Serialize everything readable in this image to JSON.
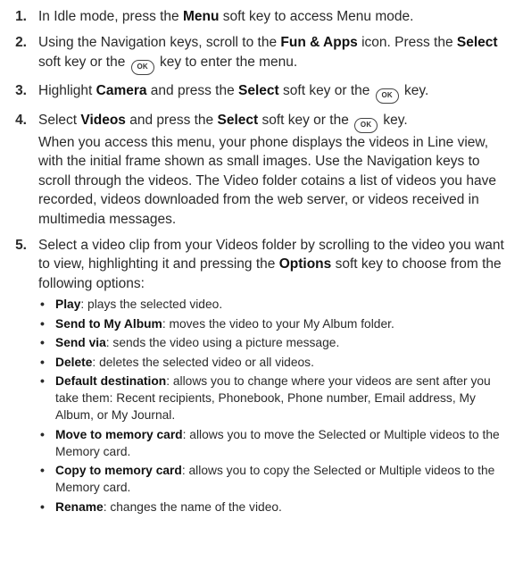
{
  "ok_key_label": "OK",
  "steps": [
    {
      "num": "1.",
      "parts": [
        "In Idle mode, press the ",
        "Menu",
        " soft key to access Menu mode."
      ]
    },
    {
      "num": "2.",
      "parts": [
        "Using the Navigation keys, scroll to the ",
        "Fun & Apps",
        " icon. Press the ",
        "Select",
        " soft key or the ",
        " key to enter the menu."
      ]
    },
    {
      "num": "3.",
      "parts": [
        "Highlight ",
        "Camera",
        " and press the ",
        "Select",
        " soft key or the ",
        " key."
      ]
    },
    {
      "num": "4.",
      "parts": [
        "Select ",
        "Videos",
        " and press the ",
        "Select",
        " soft key or the ",
        " key."
      ],
      "para": "When you access this menu, your phone displays the videos in Line view, with the initial frame shown as small images. Use the Navigation keys to scroll through the videos. The Video folder cotains a list of videos you have recorded, videos downloaded from the web server, or videos received in multimedia messages."
    },
    {
      "num": "5.",
      "parts": [
        "Select a video clip from your Videos folder by scrolling to the video you want to view, highlighting it and pressing the ",
        "Options",
        " soft key to choose from the following options:"
      ]
    }
  ],
  "options": [
    {
      "term": "Play",
      "desc": ": plays the selected video."
    },
    {
      "term": "Send to My Album",
      "desc": ": moves the video to your My Album folder."
    },
    {
      "term": "Send via",
      "desc": ": sends the video using a picture message."
    },
    {
      "term": "Delete",
      "desc": ": deletes the selected video or all videos."
    },
    {
      "term": "Default destination",
      "desc": ": allows you to change where your videos are sent after you take them: Recent recipients, Phonebook, Phone number, Email address, My Album, or My Journal."
    },
    {
      "term": "Move to memory card",
      "desc": ": allows you to move the Selected or Multiple videos to the Memory card."
    },
    {
      "term": "Copy to memory card",
      "desc": ": allows you to copy the Selected or Multiple videos to the Memory card."
    },
    {
      "term": "Rename",
      "desc": ": changes the name of the video."
    }
  ]
}
